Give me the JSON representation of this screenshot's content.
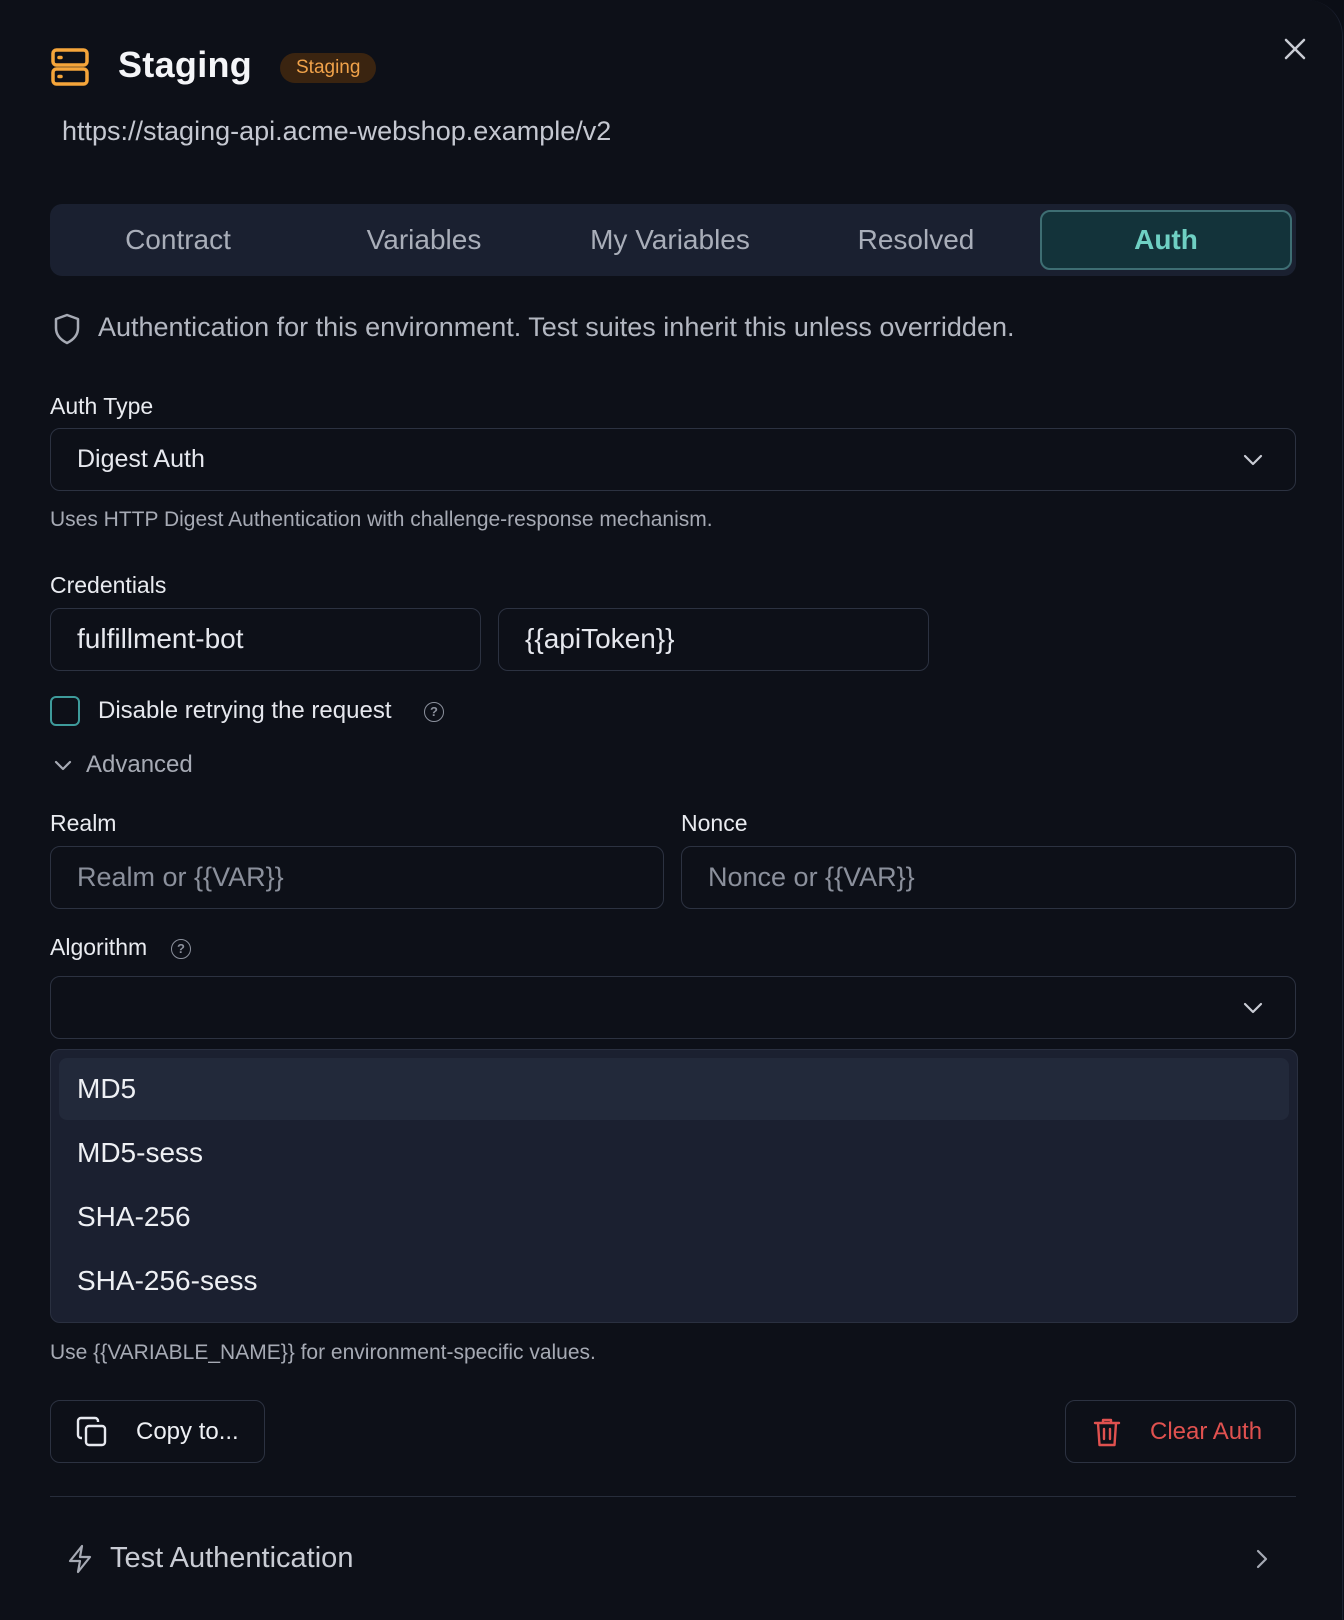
{
  "header": {
    "title": "Staging",
    "badge": "Staging",
    "url": "https://staging-api.acme-webshop.example/v2",
    "icon": "server-icon",
    "close_icon": "close-icon"
  },
  "tabs": [
    {
      "label": "Contract",
      "active": false
    },
    {
      "label": "Variables",
      "active": false
    },
    {
      "label": "My Variables",
      "active": false
    },
    {
      "label": "Resolved",
      "active": false
    },
    {
      "label": "Auth",
      "active": true
    }
  ],
  "info": {
    "icon": "shield-icon",
    "text": "Authentication for this environment. Test suites inherit this unless overridden."
  },
  "auth_type": {
    "label": "Auth Type",
    "value": "Digest Auth",
    "help": "Uses HTTP Digest Authentication with challenge-response mechanism."
  },
  "credentials": {
    "label": "Credentials",
    "username": "fulfillment-bot",
    "password": "{{apiToken}}"
  },
  "retry": {
    "label": "Disable retrying the request",
    "checked": false
  },
  "advanced": {
    "label": "Advanced",
    "realm_label": "Realm",
    "realm_placeholder": "Realm or {{VAR}}",
    "nonce_label": "Nonce",
    "nonce_placeholder": "Nonce or {{VAR}}",
    "algorithm_label": "Algorithm",
    "algorithm_value": "",
    "algorithm_options": [
      "MD5",
      "MD5-sess",
      "SHA-256",
      "SHA-256-sess"
    ],
    "highlighted_option": "MD5"
  },
  "footer": {
    "hint": "Use {{VARIABLE_NAME}} for environment-specific values.",
    "copy_label": "Copy to...",
    "clear_label": "Clear Auth",
    "test_label": "Test Authentication"
  },
  "colors": {
    "accent": "#6fd0c3",
    "badge": "#f0a24a",
    "danger": "#e0514f"
  }
}
